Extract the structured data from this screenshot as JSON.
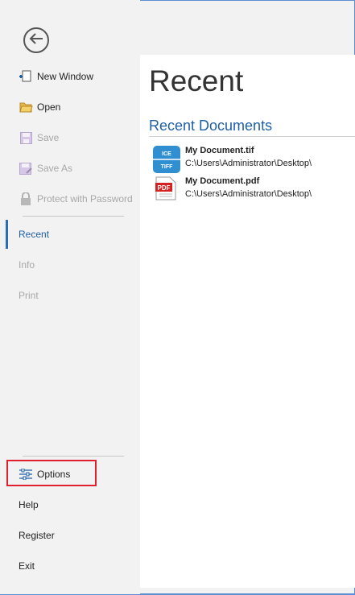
{
  "sidebar": {
    "items": [
      {
        "label": "New Window",
        "icon": "new-window-icon",
        "state": "normal"
      },
      {
        "label": "Open",
        "icon": "folder-icon",
        "state": "normal"
      },
      {
        "label": "Save",
        "icon": "save-icon",
        "state": "disabled"
      },
      {
        "label": "Save As",
        "icon": "save-as-icon",
        "state": "disabled"
      },
      {
        "label": "Protect with Password",
        "icon": "lock-icon",
        "state": "disabled"
      },
      {
        "label": "Recent",
        "state": "selected"
      },
      {
        "label": "Info",
        "state": "disabled"
      },
      {
        "label": "Print",
        "state": "disabled"
      },
      {
        "label": "Options",
        "icon": "sliders-icon",
        "state": "highlighted"
      },
      {
        "label": "Help",
        "state": "normal"
      },
      {
        "label": "Register",
        "state": "normal"
      },
      {
        "label": "Exit",
        "state": "normal"
      }
    ]
  },
  "main": {
    "title": "Recent",
    "section_title": "Recent Documents",
    "files": [
      {
        "name": "My Document.tif",
        "path": "C:\\Users\\Administrator\\Desktop\\",
        "icon": "tif-file-icon",
        "icon_top": "ICE",
        "icon_bottom": "TIFF"
      },
      {
        "name": "My Document.pdf",
        "path": "C:\\Users\\Administrator\\Desktop\\",
        "icon": "pdf-file-icon",
        "icon_text": "PDF"
      }
    ]
  },
  "colors": {
    "accent": "#1e5fa8",
    "highlight_border": "#e0202e",
    "sidebar_bg": "#f2f2f2",
    "content_bg": "#ffffff",
    "disabled_text": "#a8a8a8"
  }
}
